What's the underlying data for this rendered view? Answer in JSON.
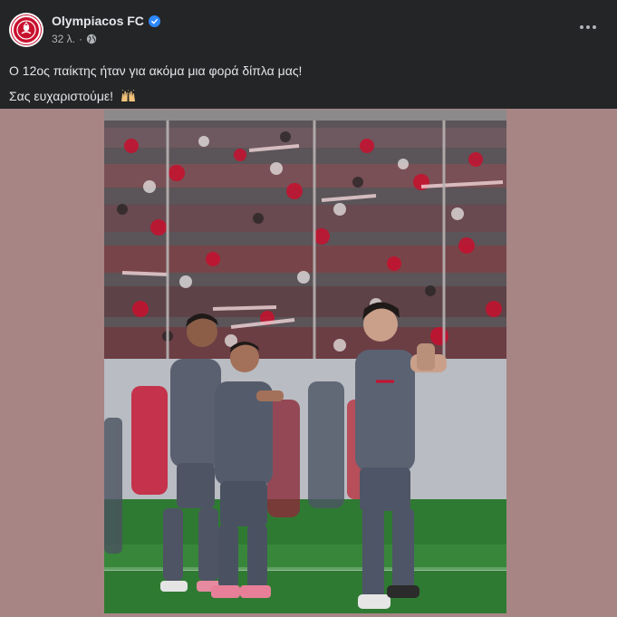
{
  "post": {
    "page_name": "Olympiacos FC",
    "timestamp": "32 λ.",
    "separator": "·",
    "text_line1": "Ο 12ος παίκτης ήταν για ακόμα μια φορά δίπλα μας!",
    "text_line2": "Σας ευχαριστούμε!",
    "emoji": "raising-hands-emoji",
    "audience": "public-globe-icon",
    "verified": true
  },
  "colors": {
    "background": "#242526",
    "media_backdrop": "#a68584",
    "text_primary": "#e4e6eb",
    "text_secondary": "#b0b3b8",
    "verified_blue": "#2d88ff",
    "brand_red": "#c8102e"
  },
  "icons": {
    "avatar": "olympiacos-crest-icon",
    "verified": "verified-badge-icon",
    "globe": "globe-icon",
    "more": "more-options-icon"
  }
}
